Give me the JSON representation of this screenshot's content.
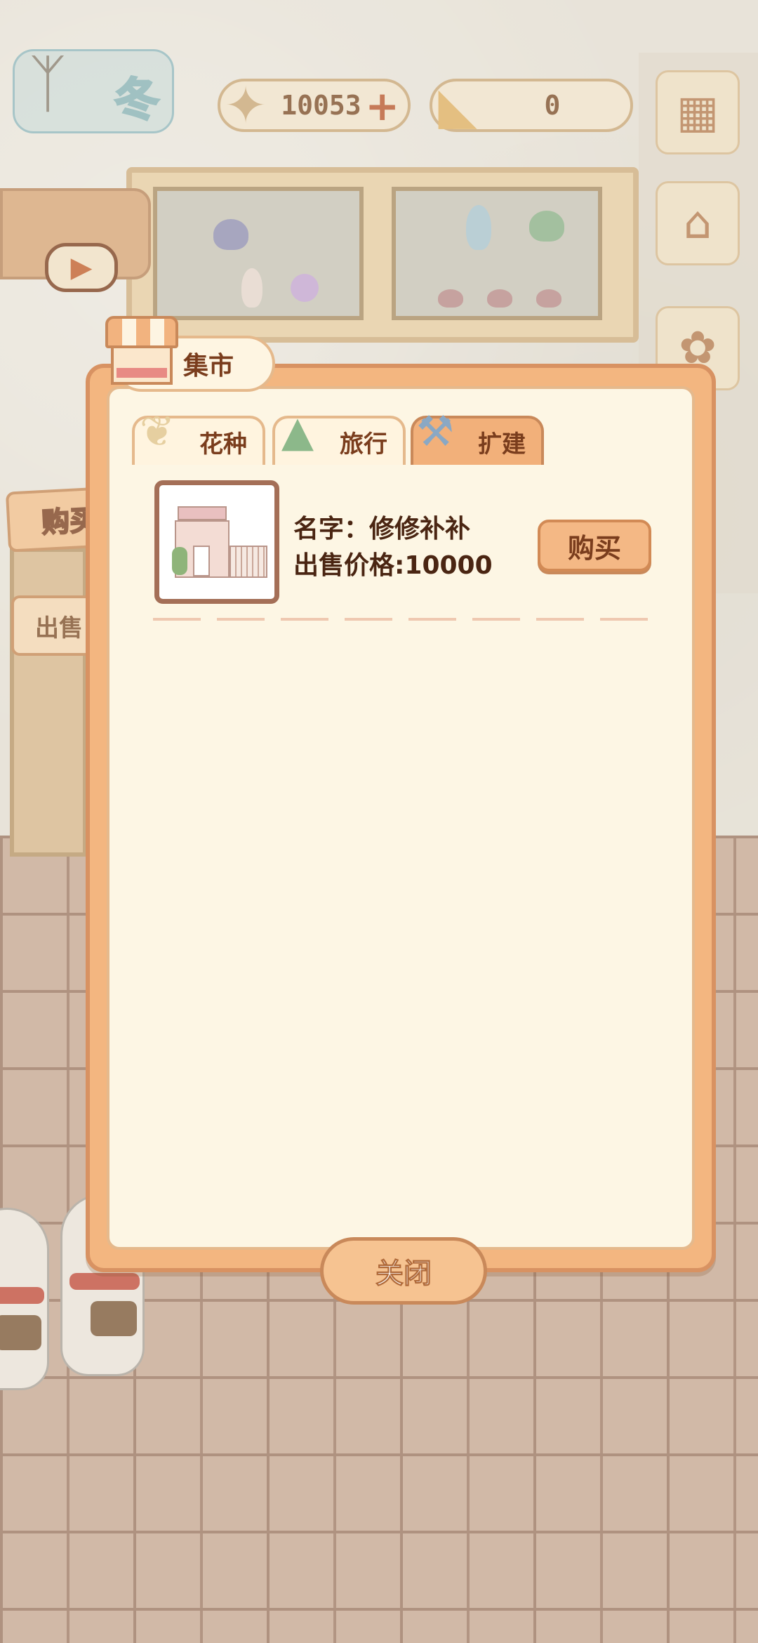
{
  "hud": {
    "season": "冬",
    "fish_count": "10053",
    "cheese_count": "0",
    "fish_icon": "fish-bone-icon",
    "cheese_icon": "cheese-icon"
  },
  "side_tabs": {
    "buy": "购买",
    "sell": "出售"
  },
  "modal": {
    "title": "集市",
    "tabs": [
      {
        "label": "花种",
        "icon": "seed-bag-icon",
        "active": false
      },
      {
        "label": "旅行",
        "icon": "rice-dumpling-icon",
        "active": false
      },
      {
        "label": "扩建",
        "icon": "hammer-icon",
        "active": true
      }
    ],
    "items": [
      {
        "name_line": "名字：修修补补",
        "price_line": "出售价格:10000",
        "buy_label": "购买"
      }
    ],
    "close_label": "关闭"
  },
  "colors": {
    "modal_bg": "#f3b680",
    "panel_bg": "#fdf6e4",
    "text_brown": "#7a3d1d",
    "active_tab": "#f2b07a"
  }
}
